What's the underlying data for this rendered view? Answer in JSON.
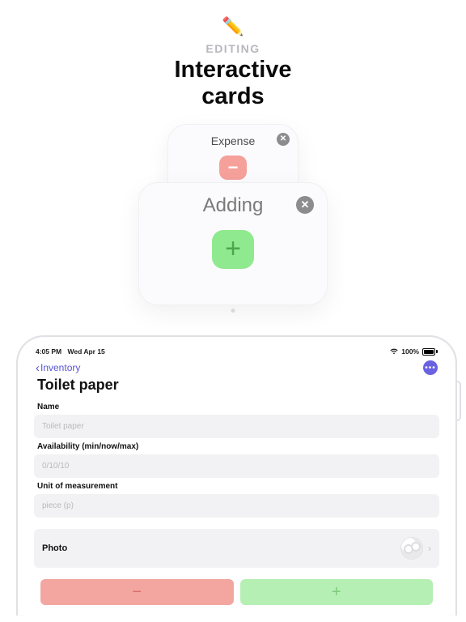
{
  "hero": {
    "icon": "✏️",
    "eyebrow": "EDITING",
    "title_line1": "Interactive",
    "title_line2": "cards"
  },
  "cards": {
    "expense": {
      "label": "Expense",
      "glyph": "−"
    },
    "adding": {
      "label": "Adding",
      "glyph": "+"
    }
  },
  "device": {
    "status": {
      "time": "4:05 PM",
      "date": "Wed Apr 15",
      "battery_pct": "100%"
    },
    "nav": {
      "back_label": "Inventory",
      "more_glyph": "•••"
    },
    "page_title": "Toilet paper",
    "form": {
      "name": {
        "label": "Name",
        "placeholder": "Toilet paper"
      },
      "availability": {
        "label": "Availability (min/now/max)",
        "placeholder": "0/10/10"
      },
      "unit": {
        "label": "Unit of measurement",
        "placeholder": "piece (p)"
      },
      "photo_label": "Photo"
    },
    "buttons": {
      "minus": "−",
      "plus": "+"
    }
  }
}
